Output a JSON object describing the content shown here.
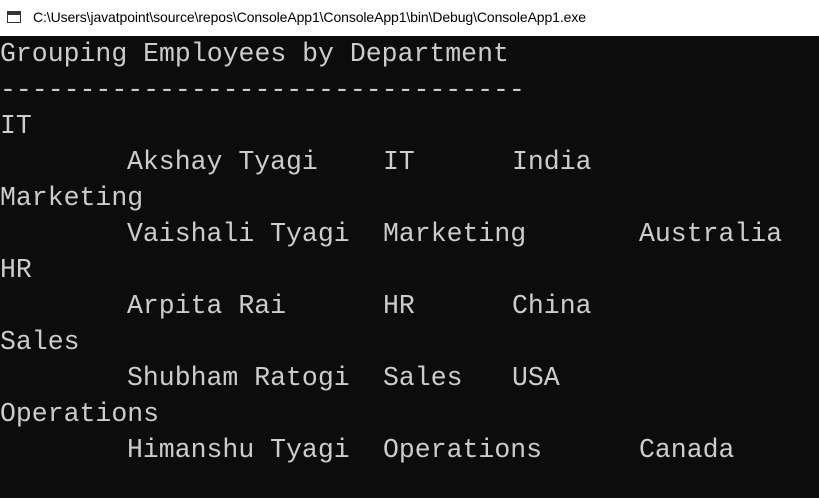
{
  "window": {
    "title": "C:\\Users\\javatpoint\\source\\repos\\ConsoleApp1\\ConsoleApp1\\bin\\Debug\\ConsoleApp1.exe",
    "icon": "console-window-icon"
  },
  "console": {
    "heading": "Grouping Employees by Department",
    "separator": "---------------------------------",
    "groups": [
      {
        "department": "IT",
        "employee": {
          "name": "Akshay Tyagi",
          "dept": "IT",
          "country": "India"
        }
      },
      {
        "department": "Marketing",
        "employee": {
          "name": "Vaishali Tyagi",
          "dept": "Marketing",
          "country": "Australia"
        }
      },
      {
        "department": "HR",
        "employee": {
          "name": "Arpita Rai",
          "dept": "HR",
          "country": "China"
        }
      },
      {
        "department": "Sales",
        "employee": {
          "name": "Shubham Ratogi",
          "dept": "Sales",
          "country": "USA"
        }
      },
      {
        "department": "Operations",
        "employee": {
          "name": "Himanshu Tyagi",
          "dept": "Operations",
          "country": "Canada"
        }
      }
    ]
  },
  "colors": {
    "console_bg": "#0c0c0c",
    "console_fg": "#cccccc",
    "titlebar_bg": "#ffffff"
  }
}
